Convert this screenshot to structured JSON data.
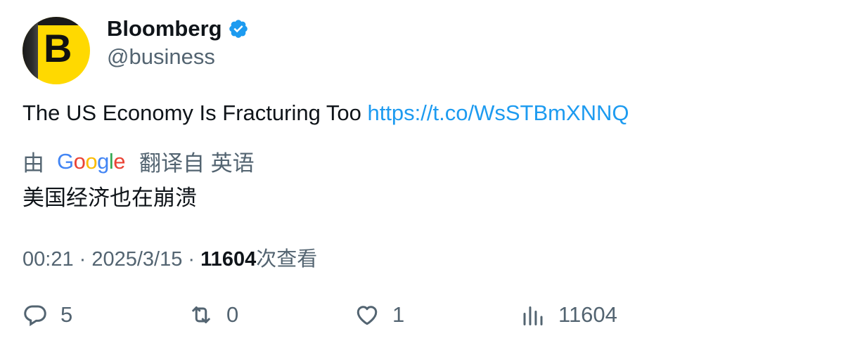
{
  "author": {
    "avatar_letter": "B",
    "display_name": "Bloomberg",
    "handle": "@business"
  },
  "tweet": {
    "text": "The US Economy Is Fracturing Too ",
    "link": "https://t.co/WsSTBmXNNQ"
  },
  "translation": {
    "prefix": "由",
    "provider_logo": "Google",
    "label": "翻译自 英语",
    "text": "美国经济也在崩溃"
  },
  "meta": {
    "time": "00:21",
    "sep1": " · ",
    "date": "2025/3/15",
    "sep2": " · ",
    "views_count": "11604",
    "views_label": "次查看"
  },
  "actions": {
    "replies": "5",
    "retweets": "0",
    "likes": "1",
    "views": "11604"
  },
  "colors": {
    "accent": "#1d9bf0",
    "secondary_text": "#536471",
    "avatar_bg": "#ffd900"
  }
}
